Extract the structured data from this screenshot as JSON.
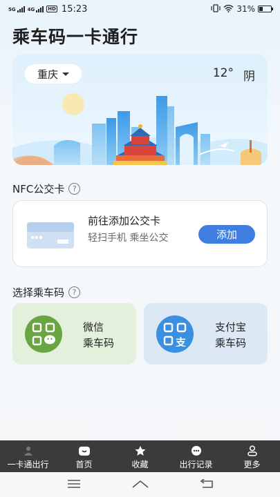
{
  "status": {
    "network": "5G",
    "network2": "4G",
    "hd": "HD",
    "time": "15:23",
    "battery_pct": "31%",
    "battery_level": 0.31
  },
  "app_title": "乘车码一卡通行",
  "hero": {
    "city": "重庆",
    "temperature": "12°",
    "weather": "阴"
  },
  "nfc": {
    "section_title": "NFC公交卡",
    "card_title": "前往添加公交卡",
    "card_subtitle": "轻扫手机  乘坐公交",
    "add_label": "添加"
  },
  "ride_code": {
    "section_title": "选择乘车码",
    "options": [
      {
        "line1": "微信",
        "line2": "乘车码",
        "icon": "wechat-qr-icon"
      },
      {
        "line1": "支付宝",
        "line2": "乘车码",
        "icon": "alipay-qr-icon"
      }
    ]
  },
  "bottom_nav": [
    {
      "label": "一卡通出行",
      "icon": "card-icon"
    },
    {
      "label": "首页",
      "icon": "home-icon"
    },
    {
      "label": "收藏",
      "icon": "star-icon"
    },
    {
      "label": "出行记录",
      "icon": "record-icon"
    },
    {
      "label": "更多",
      "icon": "user-icon"
    }
  ],
  "colors": {
    "accent": "#3f7ee0",
    "wechat": "#6aa544",
    "alipay": "#3b8fe0",
    "nav_bg": "#3b3b3b"
  }
}
